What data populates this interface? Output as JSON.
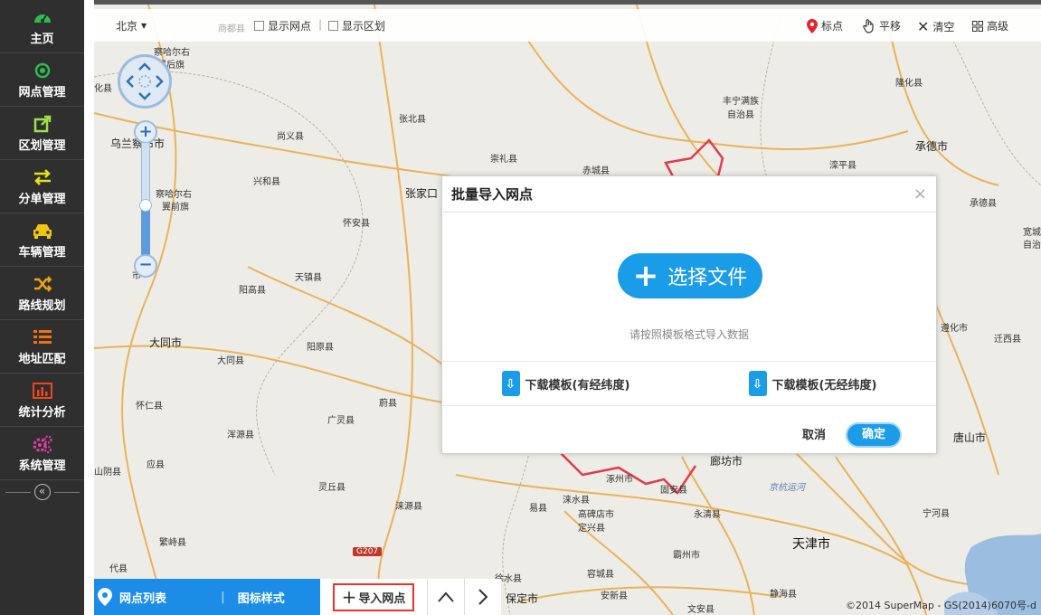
{
  "sidebar": {
    "items": [
      {
        "label": "主页",
        "icon": "dashboard-icon",
        "color": "#2dbd4e"
      },
      {
        "label": "网点管理",
        "icon": "target-icon",
        "color": "#2dbd4e"
      },
      {
        "label": "区划管理",
        "icon": "external-link-icon",
        "color": "#9be24a"
      },
      {
        "label": "分单管理",
        "icon": "exchange-icon",
        "color": "#e5e020"
      },
      {
        "label": "车辆管理",
        "icon": "car-icon",
        "color": "#f2c513"
      },
      {
        "label": "路线规划",
        "icon": "shuffle-icon",
        "color": "#f2a313"
      },
      {
        "label": "地址匹配",
        "icon": "list-icon",
        "color": "#f27213"
      },
      {
        "label": "统计分析",
        "icon": "bar-chart-icon",
        "color": "#f2451d"
      },
      {
        "label": "系统管理",
        "icon": "gears-icon",
        "color": "#e23fa8"
      }
    ],
    "collapse_symbol": "«"
  },
  "toolbar": {
    "city": "北京",
    "show_points": "显示网点",
    "show_regions": "显示区划",
    "mark": "标点",
    "pan": "平移",
    "clear": "清空",
    "advanced": "高级"
  },
  "map_labels": {
    "l1": "察哈尔右",
    "l2": "翼后旗",
    "l3": "张北县",
    "l4": "尚义县",
    "l5": "崇礼县",
    "l6": "赤城县",
    "l7": "丰宁满族",
    "l8": "自治县",
    "l9": "隆化县",
    "l10": "承德市",
    "l11": "滦平县",
    "l12": "承德县",
    "l13": "乌兰察布市",
    "l14": "兴和县",
    "l15": "察哈尔右",
    "l16": "翼前旗",
    "l17": "张家口",
    "l18": "怀安县",
    "l19": "天镇县",
    "l20": "阳高县",
    "l21": "大同市",
    "l22": "阳原县",
    "l23": "大同县",
    "l24": "怀仁县",
    "l25": "蔚县",
    "l26": "广灵县",
    "l27": "浑源县",
    "l28": "应县",
    "l29": "山阴县",
    "l30": "灵丘县",
    "l31": "涞源县",
    "l32": "繁峙县",
    "l33": "代县",
    "l34": "易县",
    "l35": "涞水县",
    "l36": "涿州市",
    "l37": "高碑店市",
    "l38": "定兴县",
    "l39": "固安县",
    "l40": "永清县",
    "l41": "廊坊市",
    "l42": "霸州市",
    "l43": "天津市",
    "l44": "宁河县",
    "l45": "唐山市",
    "l46": "遵化市",
    "l47": "迁西县",
    "l48": "徐水县",
    "l49": "容城县",
    "l50": "安新县",
    "l51": "保定市",
    "l52": "文安县",
    "l53": "静海县",
    "l54": "京杭运河",
    "l55": "宽城",
    "l56": "自治",
    "l57": "化县",
    "l58": "市",
    "l59": "商都县",
    "l60": "承德县"
  },
  "road_sign": "G207",
  "copyright": "©2014 SuperMap - GS(2014)6070号-d",
  "dialog": {
    "title": "批量导入网点",
    "close": "×",
    "choose_file": "选择文件",
    "hint": "请按照模板格式导入数据",
    "download_with": "下载模板(有经纬度)",
    "download_without": "下载模板(无经纬度)",
    "cancel": "取消",
    "confirm": "确定"
  },
  "bottombar": {
    "point_list": "网点列表",
    "icon_style": "图标样式",
    "import_points": "导入网点"
  },
  "colors": {
    "accent": "#1b9ce9",
    "sidebar_bg": "#2f2f2f",
    "highlight_border": "#e8332e"
  }
}
